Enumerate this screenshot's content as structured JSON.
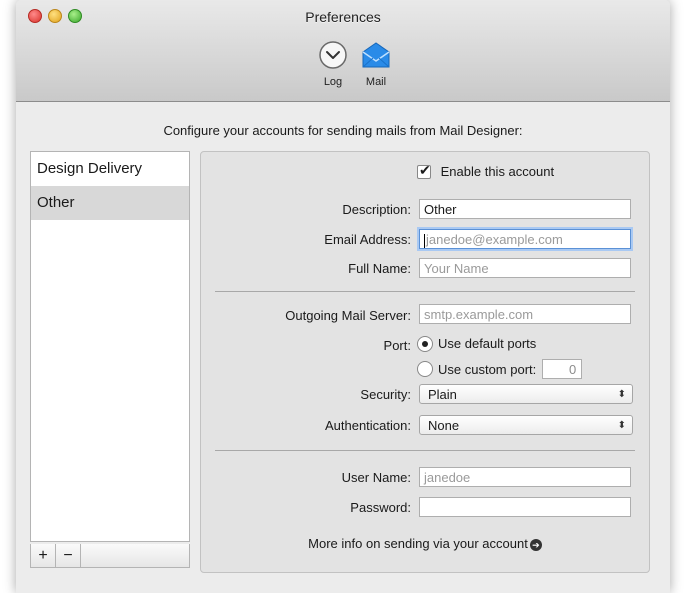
{
  "window": {
    "title": "Preferences"
  },
  "toolbar": {
    "items": [
      {
        "label": "Log",
        "icon": "clock-icon"
      },
      {
        "label": "Mail",
        "icon": "envelope-icon",
        "selected": true
      }
    ]
  },
  "instruction": "Configure your accounts for sending mails from Mail Designer:",
  "accounts": [
    {
      "name": "Design Delivery",
      "selected": false
    },
    {
      "name": "Other",
      "selected": true
    }
  ],
  "list_buttons": {
    "add": "+",
    "remove": "−"
  },
  "form": {
    "enable_label": "Enable this account",
    "enable_checked": true,
    "description_label": "Description:",
    "description_value": "Other",
    "email_label": "Email Address:",
    "email_placeholder": "janedoe@example.com",
    "fullname_label": "Full Name:",
    "fullname_placeholder": "Your Name",
    "server_label": "Outgoing Mail Server:",
    "server_placeholder": "smtp.example.com",
    "port_label": "Port:",
    "port_default_label": "Use default ports",
    "port_custom_label": "Use custom port:",
    "port_value": "0",
    "security_label": "Security:",
    "security_value": "Plain",
    "auth_label": "Authentication:",
    "auth_value": "None",
    "username_label": "User Name:",
    "username_placeholder": "janedoe",
    "password_label": "Password:",
    "password_value": "",
    "more_info": "More info on sending via your account"
  },
  "colors": {
    "accent_blue": "#2a8be8",
    "window_bg": "#ececec",
    "panel_bg": "#e3e3e3",
    "focus_ring": "#a9c9f3"
  }
}
